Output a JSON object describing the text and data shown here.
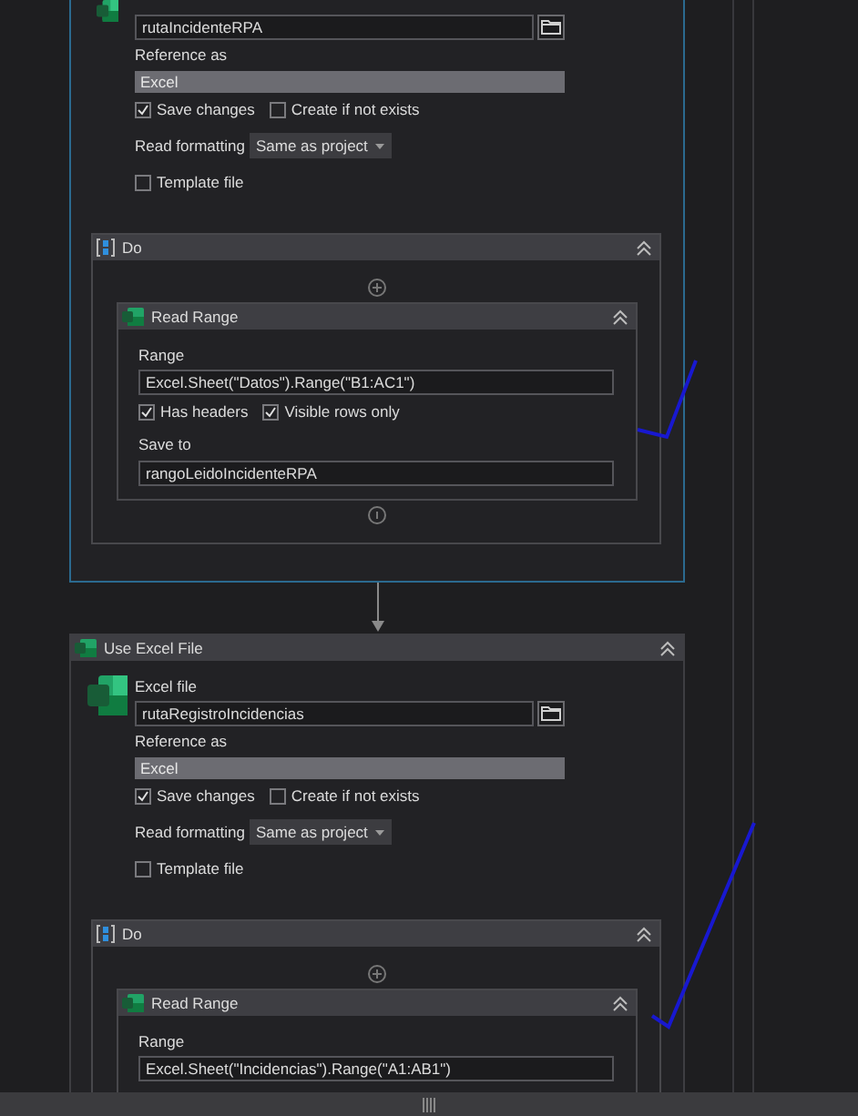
{
  "activities": [
    {
      "selected": true,
      "file": "rutaIncidenteRPA",
      "reference_label": "Reference as",
      "reference": "Excel",
      "options": [
        {
          "label": "Save changes",
          "checked": true
        },
        {
          "label": "Create if not exists",
          "checked": false
        }
      ],
      "formatting_label": "Read formatting",
      "formatting": "Same as project",
      "template": {
        "label": "Template file",
        "checked": false
      },
      "do": {
        "title": "Do",
        "activities": [
          {
            "title": "Read Range",
            "range_label": "Range",
            "range": "Excel.Sheet(\"Datos\").Range(\"B1:AC1\")",
            "options": [
              {
                "label": "Has headers",
                "checked": true
              },
              {
                "label": "Visible rows only",
                "checked": true
              }
            ],
            "save_label": "Save to",
            "save": "rangoLeidoIncidenteRPA"
          }
        ]
      }
    },
    {
      "selected": false,
      "title": "Use Excel File",
      "file_label": "Excel file",
      "file": "rutaRegistroIncidencias",
      "reference_label": "Reference as",
      "reference": "Excel",
      "options": [
        {
          "label": "Save changes",
          "checked": true
        },
        {
          "label": "Create if not exists",
          "checked": false
        }
      ],
      "formatting_label": "Read formatting",
      "formatting": "Same as project",
      "template": {
        "label": "Template file",
        "checked": false
      },
      "do": {
        "title": "Do",
        "activities": [
          {
            "title": "Read Range",
            "range_label": "Range",
            "range": "Excel.Sheet(\"Incidencias\").Range(\"A1:AB1\")"
          }
        ]
      }
    }
  ]
}
